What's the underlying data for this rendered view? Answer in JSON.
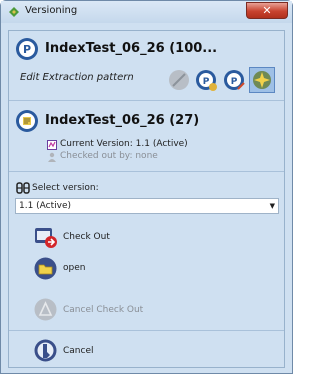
{
  "window": {
    "title": "Versioning",
    "close_glyph": "✕"
  },
  "header": {
    "title": "IndexTest_06_26 (100...",
    "subtitle": "Edit Extraction pattern"
  },
  "toolbar": {
    "icons": [
      "disabled-tool-icon",
      "pattern-a-icon",
      "pattern-b-icon",
      "pattern-selected-icon"
    ]
  },
  "document": {
    "title": "IndexTest_06_26 (27)",
    "current_version": "Current Version: 1.1 (Active)",
    "checked_out_by": "Checked out by: none"
  },
  "version_select": {
    "label": "Select version:",
    "value": "1.1 (Active)"
  },
  "actions": {
    "check_out": "Check Out",
    "open": "open",
    "cancel_check_out": "Cancel Check Out",
    "cancel": "Cancel"
  },
  "colors": {
    "background": "#cfe0f1",
    "accent": "#2a5a9e",
    "close": "#c8422e"
  }
}
